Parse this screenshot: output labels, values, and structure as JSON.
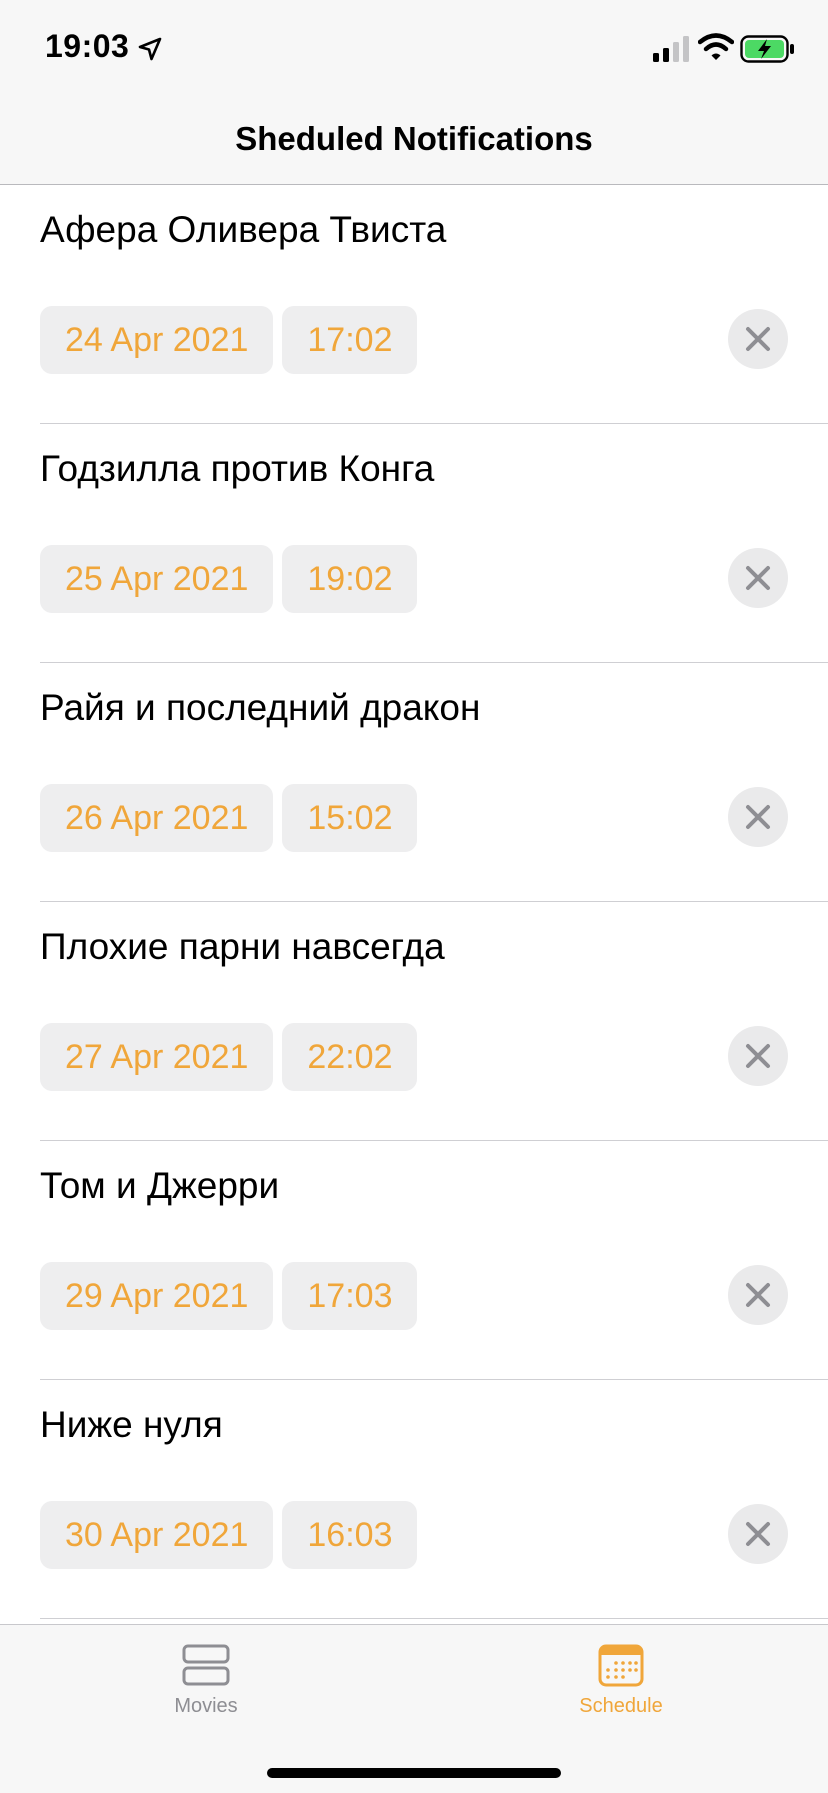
{
  "status_bar": {
    "time": "19:03"
  },
  "nav": {
    "title": "Sheduled Notifications"
  },
  "notifications": [
    {
      "title": "Афера Оливера Твиста",
      "date": "24 Apr 2021",
      "time": "17:02"
    },
    {
      "title": "Годзилла против Конга",
      "date": "25 Apr 2021",
      "time": "19:02"
    },
    {
      "title": "Райя и последний дракон",
      "date": "26 Apr 2021",
      "time": "15:02"
    },
    {
      "title": "Плохие парни навсегда",
      "date": "27 Apr 2021",
      "time": "22:02"
    },
    {
      "title": "Том и Джерри",
      "date": "29 Apr 2021",
      "time": "17:03"
    },
    {
      "title": "Ниже нуля",
      "date": "30 Apr 2021",
      "time": "16:03"
    }
  ],
  "tabs": [
    {
      "label": "Movies",
      "icon": "rows-icon",
      "selected": false
    },
    {
      "label": "Schedule",
      "icon": "calendar-icon",
      "selected": true
    }
  ],
  "colors": {
    "accent": "#f0a63a",
    "chip_background": "#eeeeef",
    "inactive_tab": "#8e8e93",
    "battery_fill": "#4cd964"
  }
}
